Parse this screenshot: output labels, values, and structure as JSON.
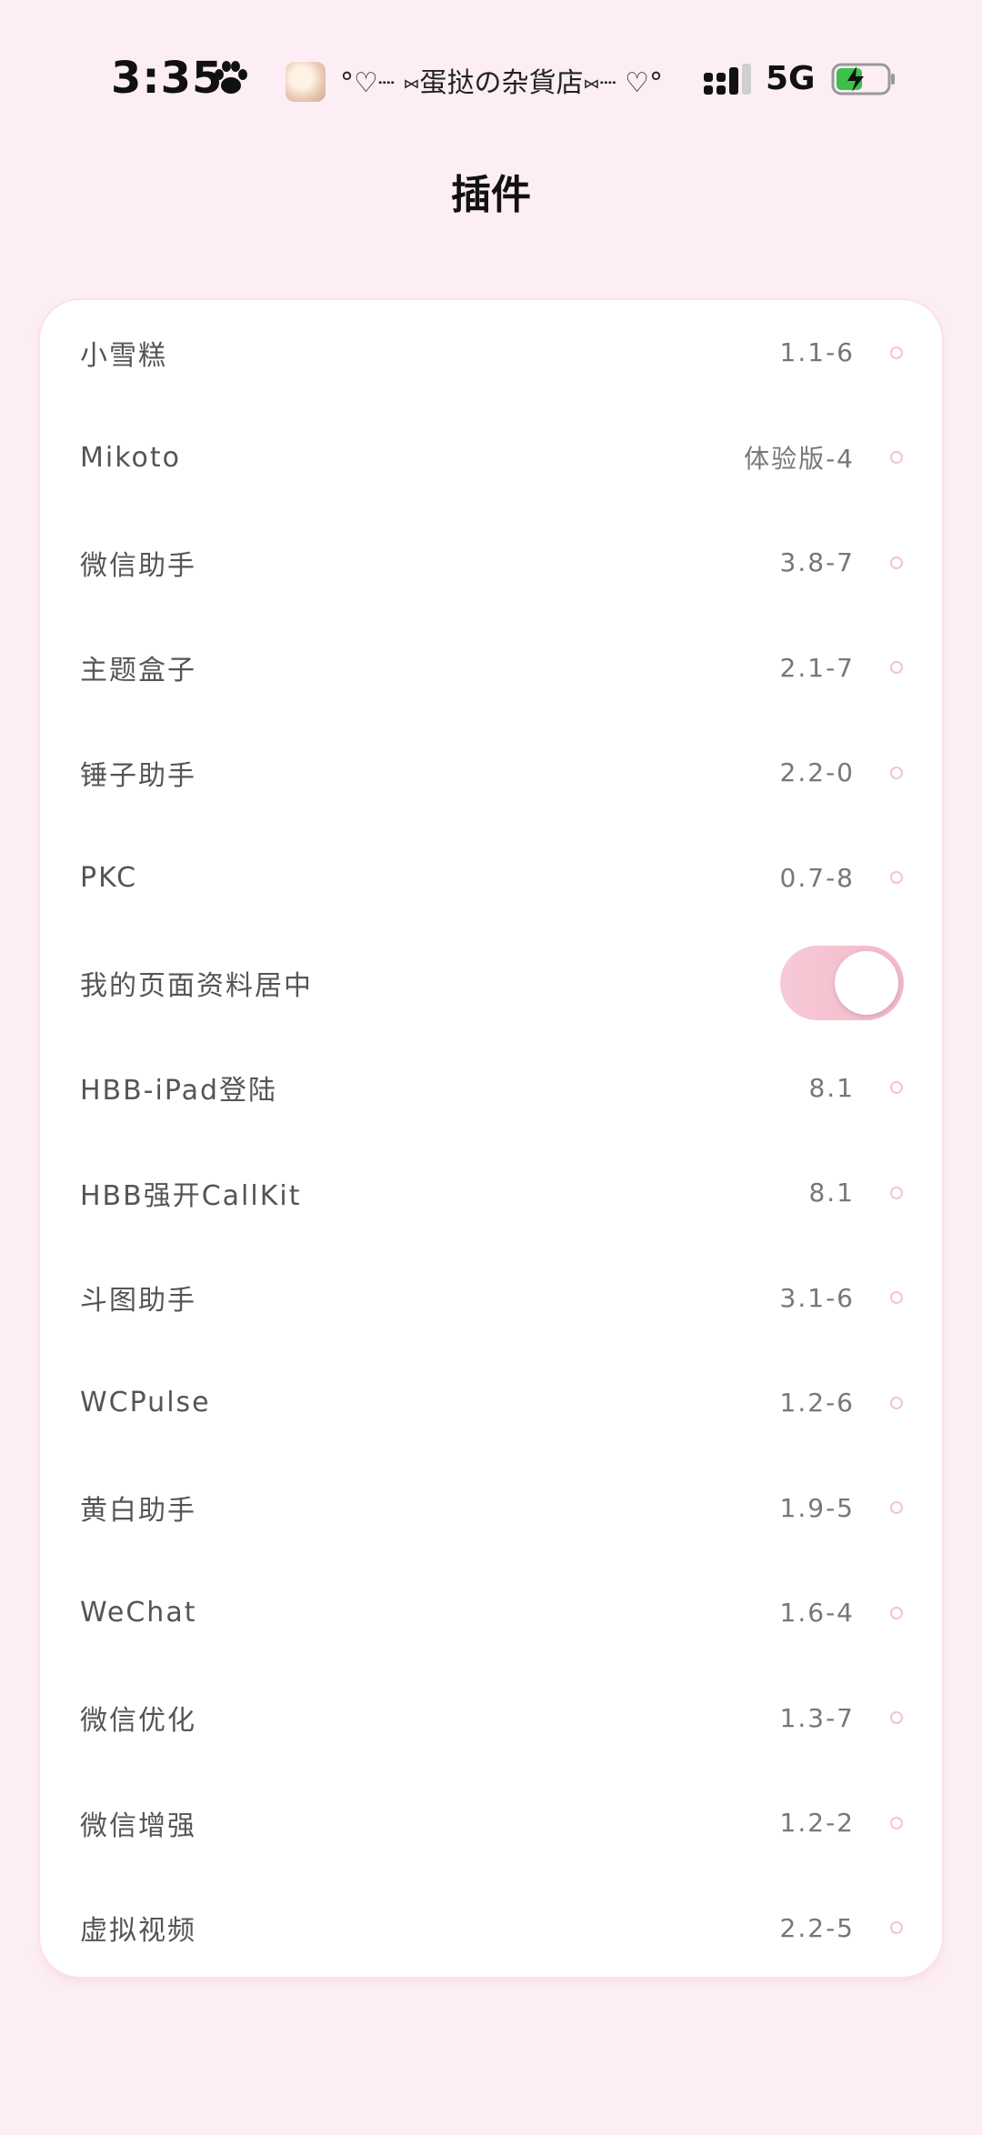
{
  "status_bar": {
    "time": "3:35",
    "carrier_text": "°♡┈ ⑅蛋挞の杂貨店⑅┈ ♡°",
    "network": "5G",
    "icons": [
      "paw-icon",
      "avatar",
      "signal-icon",
      "battery-charging-icon"
    ]
  },
  "page": {
    "title": "插件"
  },
  "plugins": [
    {
      "name": "小雪糕",
      "value": "1.1-6"
    },
    {
      "name": "Mikoto",
      "value": "体验版-4"
    },
    {
      "name": "微信助手",
      "value": "3.8-7"
    },
    {
      "name": "主题盒子",
      "value": "2.1-7"
    },
    {
      "name": "锤子助手",
      "value": "2.2-0"
    },
    {
      "name": "PKC",
      "value": "0.7-8"
    },
    {
      "name": "我的页面资料居中",
      "toggle": true
    },
    {
      "name": "HBB-iPad登陆",
      "value": "8.1"
    },
    {
      "name": "HBB强开CallKit",
      "value": "8.1"
    },
    {
      "name": "斗图助手",
      "value": "3.1-6"
    },
    {
      "name": "WCPulse",
      "value": "1.2-6"
    },
    {
      "name": "黄白助手",
      "value": "1.9-5"
    },
    {
      "name": "WeChat",
      "value": "1.6-4"
    },
    {
      "name": "微信优化",
      "value": "1.3-7"
    },
    {
      "name": "微信增强",
      "value": "1.2-2"
    },
    {
      "name": "虚拟视频",
      "value": "2.2-5"
    }
  ],
  "colors": {
    "background": "#fdeef5",
    "accent": "#f4c3d1",
    "card": "#ffffff"
  }
}
